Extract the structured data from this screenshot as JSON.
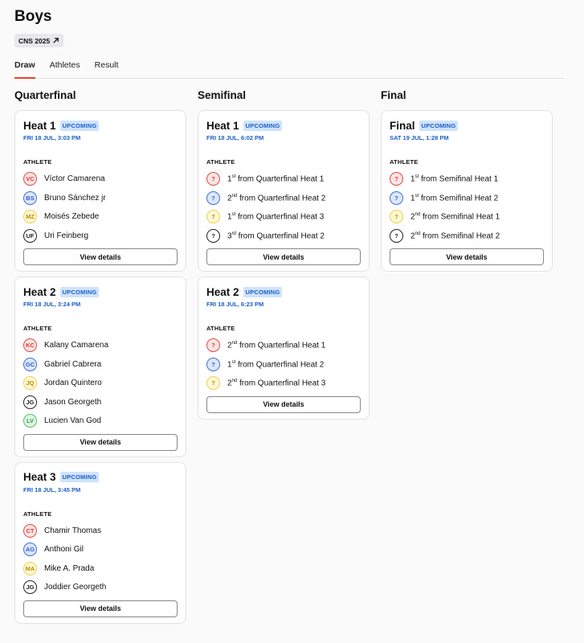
{
  "page": {
    "title": "Boys",
    "chip": "CNS 2025"
  },
  "tabs": [
    "Draw",
    "Athletes",
    "Result"
  ],
  "athlete_label": "ATHLETE",
  "view_details": "View details",
  "rounds": [
    {
      "title": "Quarterfinal",
      "heats": [
        {
          "title": "Heat 1",
          "status": "UPCOMING",
          "date": "FRI 18 JUL, 3:03 PM",
          "athletes": [
            {
              "initials": "VC",
              "name": "Víctor Camarena",
              "color": "red"
            },
            {
              "initials": "BS",
              "name": "Bruno Sánchez jr",
              "color": "blue"
            },
            {
              "initials": "MZ",
              "name": "Moisés Zebede",
              "color": "yellow"
            },
            {
              "initials": "UF",
              "name": "Uri Feinberg",
              "color": "black"
            }
          ]
        },
        {
          "title": "Heat 2",
          "status": "UPCOMING",
          "date": "FRI 18 JUL, 3:24 PM",
          "athletes": [
            {
              "initials": "KC",
              "name": "Kalany Camarena",
              "color": "red"
            },
            {
              "initials": "GC",
              "name": "Gabriel Cabrera",
              "color": "blue"
            },
            {
              "initials": "JQ",
              "name": "Jordan Quintero",
              "color": "yellow"
            },
            {
              "initials": "JG",
              "name": "Jason Georgeth",
              "color": "black"
            },
            {
              "initials": "LV",
              "name": "Lucien Van God",
              "color": "green"
            }
          ]
        },
        {
          "title": "Heat 3",
          "status": "UPCOMING",
          "date": "FRI 18 JUL, 3:45 PM",
          "athletes": [
            {
              "initials": "CT",
              "name": "Chamir Thomas",
              "color": "red"
            },
            {
              "initials": "AG",
              "name": "Anthoni Gil",
              "color": "blue"
            },
            {
              "initials": "MA",
              "name": "Mike A. Prada",
              "color": "yellow"
            },
            {
              "initials": "JG",
              "name": "Joddier Georgeth",
              "color": "black"
            }
          ]
        }
      ]
    },
    {
      "title": "Semifinal",
      "heats": [
        {
          "title": "Heat 1",
          "status": "UPCOMING",
          "date": "FRI 18 JUL, 6:02 PM",
          "athletes": [
            {
              "initials": "?",
              "ord": "1",
              "sup": "st",
              "name": " from Quarterfinal Heat 1",
              "color": "red"
            },
            {
              "initials": "?",
              "ord": "2",
              "sup": "nd",
              "name": " from Quarterfinal Heat 2",
              "color": "blue"
            },
            {
              "initials": "?",
              "ord": "1",
              "sup": "st",
              "name": " from Quarterfinal Heat 3",
              "color": "yellow"
            },
            {
              "initials": "?",
              "ord": "3",
              "sup": "rd",
              "name": " from Quarterfinal Heat 2",
              "color": "black"
            }
          ]
        },
        {
          "title": "Heat 2",
          "status": "UPCOMING",
          "date": "FRI 18 JUL, 6:23 PM",
          "athletes": [
            {
              "initials": "?",
              "ord": "2",
              "sup": "nd",
              "name": " from Quarterfinal Heat 1",
              "color": "red"
            },
            {
              "initials": "?",
              "ord": "1",
              "sup": "st",
              "name": " from Quarterfinal Heat 2",
              "color": "blue"
            },
            {
              "initials": "?",
              "ord": "2",
              "sup": "nd",
              "name": " from Quarterfinal Heat 3",
              "color": "yellow"
            }
          ]
        }
      ]
    },
    {
      "title": "Final",
      "heats": [
        {
          "title": "Final",
          "status": "UPCOMING",
          "date": "SAT 19 JUL, 1:28 PM",
          "athletes": [
            {
              "initials": "?",
              "ord": "1",
              "sup": "st",
              "name": " from Semifinal Heat 1",
              "color": "red"
            },
            {
              "initials": "?",
              "ord": "1",
              "sup": "st",
              "name": " from Semifinal Heat 2",
              "color": "blue"
            },
            {
              "initials": "?",
              "ord": "2",
              "sup": "nd",
              "name": " from Semifinal Heat 1",
              "color": "yellow"
            },
            {
              "initials": "?",
              "ord": "2",
              "sup": "nd",
              "name": " from Semifinal Heat 2",
              "color": "black"
            }
          ]
        }
      ]
    }
  ]
}
